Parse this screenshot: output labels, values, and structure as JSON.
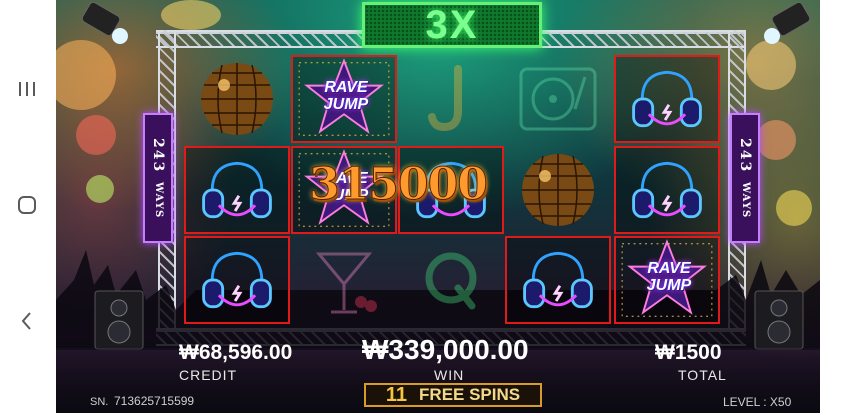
{
  "game": {
    "multiplier": "3X",
    "ways_number": "243",
    "ways_label": "WAYS",
    "symbol_rave_jump": "RAVE JUMP",
    "win_amount_overlay": "315000",
    "grid": [
      [
        "disco-ball",
        "rave-jump",
        "headphones",
        "headphones"
      ],
      [
        "rave-jump",
        "rave-jump",
        "headphones",
        "headphones"
      ],
      [
        "letter-j",
        "headphones",
        "cocktail",
        "cocktail"
      ],
      [
        "turntable",
        "disco-ball",
        "letter-q",
        "headphones"
      ],
      [
        "headphones",
        "headphones",
        "rave-jump",
        "rave-jump"
      ]
    ]
  },
  "hud": {
    "credit_value": "₩68,596.00",
    "credit_label": "CREDIT",
    "win_value": "₩339,000.00",
    "win_label": "WIN",
    "total_value": "₩1500",
    "total_label": "TOTAL",
    "free_spins_count": "11",
    "free_spins_label": "FREE SPINS",
    "serial_label": "SN.",
    "serial_value": "713625715599",
    "level_label": "LEVEL : X50"
  },
  "icons": {
    "system_nav": [
      "recent-apps-icon",
      "home-icon",
      "back-icon"
    ]
  },
  "colors": {
    "win_border": "#e01919",
    "multiplier_green": "#7dff8f",
    "ways_purple": "#c77dff",
    "win_amount_orange": "#ff9a2e",
    "free_spins_gold": "#d99b28"
  }
}
